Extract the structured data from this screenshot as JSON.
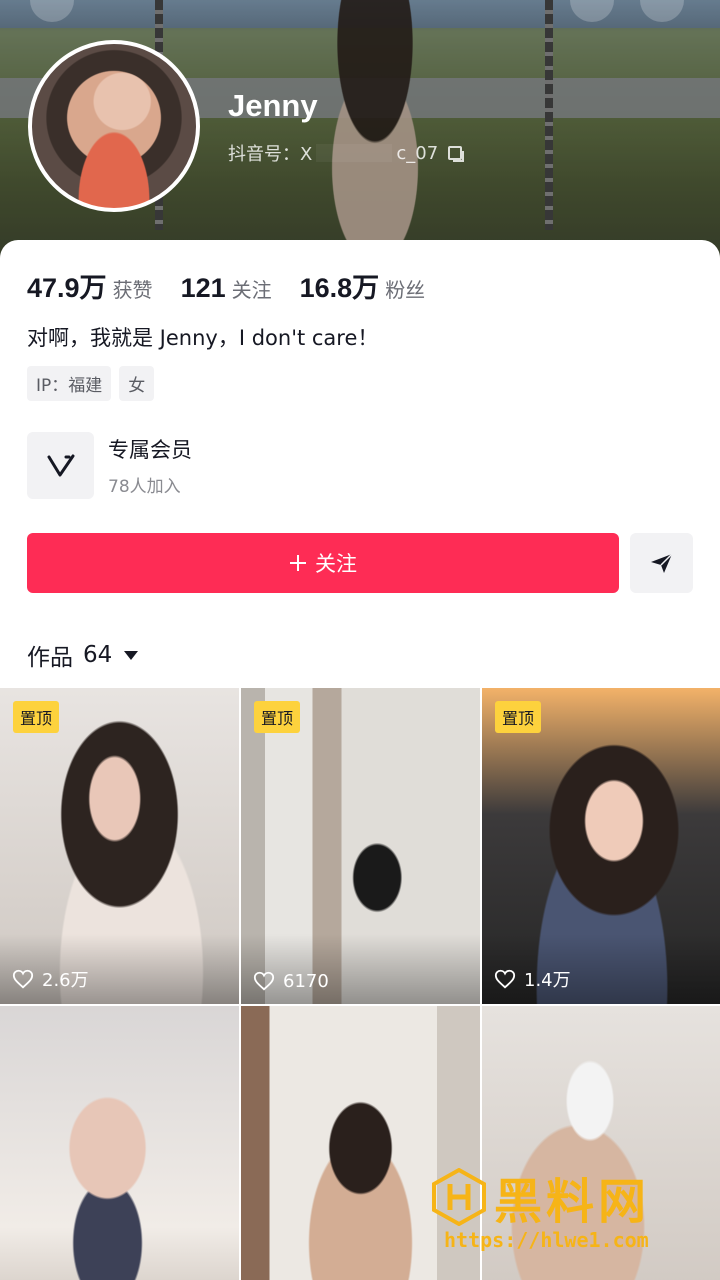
{
  "profile": {
    "name": "Jenny",
    "douyin_id": "抖音号：X",
    "douyin_id_tail": "c_07"
  },
  "stats": [
    {
      "value": "47.9万",
      "label": "获赞"
    },
    {
      "value": "121",
      "label": "关注"
    },
    {
      "value": "16.8万",
      "label": "粉丝"
    }
  ],
  "bio": "对啊，我就是 Jenny，I don't care！",
  "tags": [
    "IP：福建",
    "女"
  ],
  "membership": {
    "title": "专属会员",
    "subtitle": "78人加入"
  },
  "actions": {
    "follow_label": "关注",
    "follow_icon": "plus-icon",
    "share_icon": "send-icon"
  },
  "works": {
    "label": "作品",
    "count": "64"
  },
  "videos": [
    {
      "pinned": true,
      "pin_label": "置顶",
      "likes": "2.6万"
    },
    {
      "pinned": true,
      "pin_label": "置顶",
      "likes": "6170"
    },
    {
      "pinned": true,
      "pin_label": "置顶",
      "likes": "1.4万"
    },
    {
      "pinned": false,
      "pin_label": "",
      "likes": ""
    },
    {
      "pinned": false,
      "pin_label": "",
      "likes": ""
    },
    {
      "pinned": false,
      "pin_label": "",
      "likes": ""
    }
  ],
  "watermark": {
    "title": "黑料网",
    "url": "https://hlwe1.com"
  },
  "colors": {
    "accent": "#fe2c55",
    "pin": "#fdd23d",
    "watermark": "#f6b417"
  }
}
